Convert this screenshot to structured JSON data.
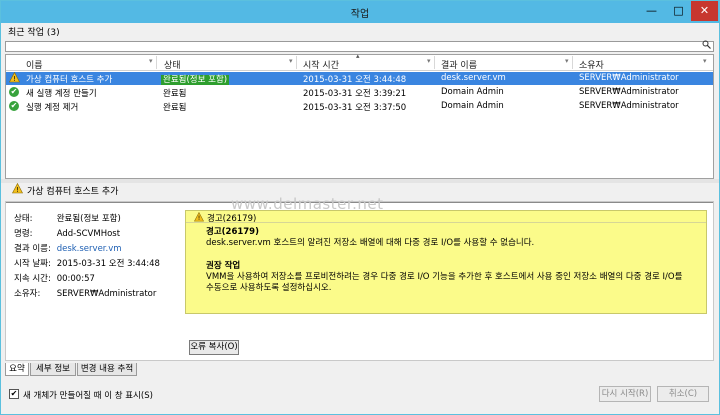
{
  "window": {
    "title": "작업",
    "min": "—",
    "max": "□",
    "close": "✕"
  },
  "recent_label": "최근 작업 (3)",
  "search": {
    "placeholder": "",
    "icon": "search-icon"
  },
  "columns": [
    "이름",
    "상태",
    "시작 시간",
    "결과 이름",
    "소유자"
  ],
  "rows": [
    {
      "icon": "warning-icon",
      "name": "가상 컴퓨터 호스트 추가",
      "status": "완료됨(정보 포함)",
      "start": "2015-03-31 오전 3:44:48",
      "result": "desk.server.vm",
      "owner": "SERVER₩Administrator",
      "selected": true
    },
    {
      "icon": "check-icon",
      "name": "새 실행 계정 만들기",
      "status": "완료됨",
      "start": "2015-03-31 오전 3:39:21",
      "result": "Domain Admin",
      "owner": "SERVER₩Administrator",
      "selected": false
    },
    {
      "icon": "check-icon",
      "name": "실행 계정 제거",
      "status": "완료됨",
      "start": "2015-03-31 오전 3:37:50",
      "result": "Domain Admin",
      "owner": "SERVER₩Administrator",
      "selected": false
    }
  ],
  "detail": {
    "title": "가상 컴퓨터 호스트 추가",
    "fields": [
      {
        "k": "상태:",
        "v": "완료됨(정보 포함)"
      },
      {
        "k": "명령:",
        "v": "Add-SCVMHost"
      },
      {
        "k": "결과 이름:",
        "v": "desk.server.vm"
      },
      {
        "k": "시작 날짜:",
        "v": "2015-03-31 오전 3:44:48"
      },
      {
        "k": "지속 시간:",
        "v": "00:00:57"
      },
      {
        "k": "소유자:",
        "v": "SERVER₩Administrator"
      }
    ],
    "watermark": "www.delmaster.net",
    "warning": {
      "header": "경고(26179)",
      "title": "경고(26179)",
      "message": "desk.server.vm 호스트의 알려진 저장소 배열에 대해 다중 경로 I/O를 사용할 수 없습니다.",
      "rec_title": "권장 작업",
      "rec_line1": "VMM을 사용하여 저장소를 프로비전하려는 경우 다중 경로 I/O 기능을 추가한 후 호스트에서 사용 중인 저장소 배열의 다중 경로 I/O를",
      "rec_line2": "수동으로 사용하도록 설정하십시오."
    },
    "copy_error": "오류 복사(O)"
  },
  "tabs": [
    "요약",
    "세부 정보",
    "변경 내용 추적"
  ],
  "footer": {
    "checkbox_checked": true,
    "checkbox_label": "새 개체가 만들어질 때 이 창 표시(S)",
    "restart": "다시 시작(R)",
    "cancel": "취소(C)"
  },
  "colors": {
    "titlebar": "#53b9e4",
    "selection": "#3a85e0",
    "warning_bg": "#fbfb8a",
    "success": "#37a23c"
  }
}
